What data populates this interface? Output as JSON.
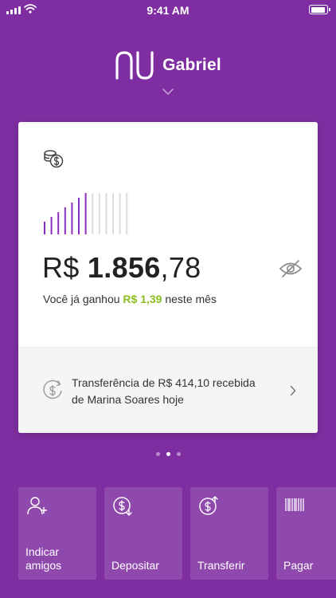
{
  "status_bar": {
    "time": "9:41 AM"
  },
  "header": {
    "user_name": "Gabriel"
  },
  "card": {
    "balance_currency": "R$ ",
    "balance_integer": "1.856",
    "balance_decimal": ",78",
    "earned_prefix": "Você já ganhou ",
    "earned_amount": "R$ 1,39",
    "earned_suffix": " neste mês",
    "transaction_text": "Transferência de R$ 414,10 recebida de Marina Soares hoje",
    "bars": {
      "filled": 7,
      "total": 13
    }
  },
  "pager": {
    "count": 3,
    "active": 2
  },
  "actions": [
    {
      "label": "Indicar\namigos",
      "icon": "add-user-icon"
    },
    {
      "label": "Depositar",
      "icon": "deposit-icon"
    },
    {
      "label": "Transferir",
      "icon": "transfer-icon"
    },
    {
      "label": "Pagar",
      "icon": "barcode-icon"
    }
  ],
  "colors": {
    "background": "#7f2ea1",
    "accent": "#8a2fbd",
    "green": "#8bbe1c"
  }
}
